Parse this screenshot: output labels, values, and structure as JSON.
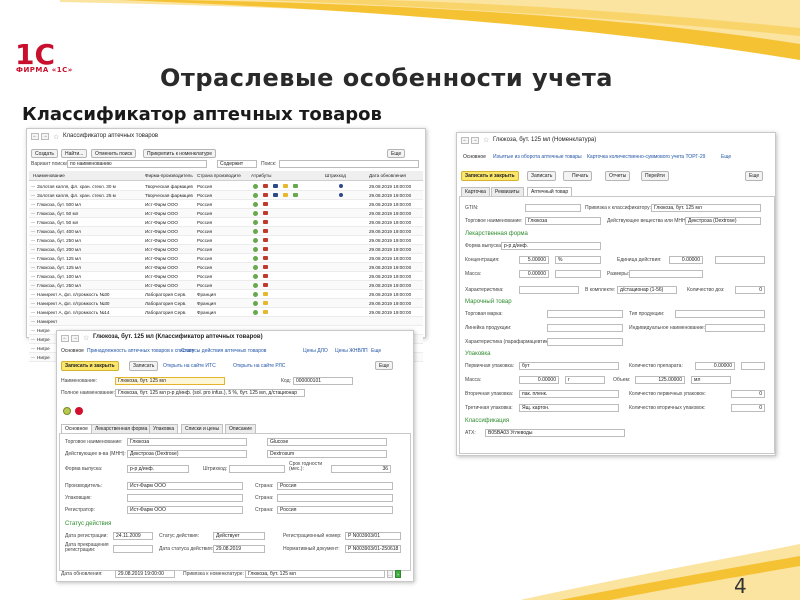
{
  "slide": {
    "logo_text": "1С",
    "logo_caption": "ФИРМА «1С»",
    "title": "Отраслевые особенности учета",
    "subtitle": "Классификатор аптечных товаров",
    "page_number": "4",
    "colors": {
      "swoosh": "#f5c233",
      "logo_red": "#c8102e",
      "section_green": "#2e8b2e",
      "link_blue": "#2255a6",
      "save_yellow": "#fbe66a"
    }
  },
  "list_window": {
    "title": "Классификатор аптечных товаров",
    "toolbar": [
      "Создать",
      "Найти...",
      "Отменить поиск",
      "Прикрепить к номенклатуре"
    ],
    "more": "Еще",
    "search_variant_label": "Вариант поиска:",
    "search_variant_value": "по наименованию",
    "search_mode": "Содержит",
    "search_label": "Поиск:",
    "columns": [
      "Наименование",
      "Фирма-производитель",
      "Страна производителя",
      "Атрибуты",
      "Штрихкод",
      "Дата обновления"
    ],
    "rows": [
      {
        "name": "Золотая капля, фл. хран. стекл. 30 м",
        "maker": "Творческая фармацев",
        "country": "Россия",
        "date": "29.08.2019 19:00:00"
      },
      {
        "name": "Золотая капля, фл. хран. стекл. 25 м",
        "maker": "Творческая фармацев",
        "country": "Россия",
        "date": "29.08.2019 19:00:00"
      },
      {
        "name": "Глюкоза, бут. 500 мл",
        "maker": "Ист-Фарм ООО",
        "country": "Россия",
        "date": "29.08.2019 19:00:00"
      },
      {
        "name": "Глюкоза, бут. 50 мл",
        "maker": "Ист-Фарм ООО",
        "country": "Россия",
        "date": "29.08.2019 19:00:00"
      },
      {
        "name": "Глюкоза, бут. 50 мл",
        "maker": "Ист-Фарм ООО",
        "country": "Россия",
        "date": "29.08.2019 19:00:00"
      },
      {
        "name": "Глюкоза, бут. 400 мл",
        "maker": "Ист-Фарм ООО",
        "country": "Россия",
        "date": "29.08.2019 19:00:00"
      },
      {
        "name": "Глюкоза, бут. 250 мл",
        "maker": "Ист-Фарм ООО",
        "country": "Россия",
        "date": "29.08.2019 19:00:00"
      },
      {
        "name": "Глюкоза, бут. 200 мл",
        "maker": "Ист-Фарм ООО",
        "country": "Россия",
        "date": "29.08.2019 19:00:00"
      },
      {
        "name": "Глюкоза, бут. 125 мл",
        "maker": "Ист-Фарм ООО",
        "country": "Россия",
        "date": "29.08.2019 19:00:00"
      },
      {
        "name": "Глюкоза, бут. 125 мл",
        "maker": "Ист-Фарм ООО",
        "country": "Россия",
        "date": "29.08.2019 19:00:00"
      },
      {
        "name": "Глюкоза, бут. 100 мл",
        "maker": "Ист-Фарм ООО",
        "country": "Россия",
        "date": "29.08.2019 19:00:00"
      },
      {
        "name": "Глюкоза, бут. 250 мл",
        "maker": "Ист-Фарм ООО",
        "country": "Россия",
        "date": "29.08.2019 19:00:00"
      },
      {
        "name": "Нанирект А, фл. п/громкость №30",
        "maker": "Лаборатория Серв.",
        "country": "Франция",
        "date": "29.08.2019 19:00:00"
      },
      {
        "name": "Нанирект А, фл. п/громкость №30",
        "maker": "Лаборатория Серв.",
        "country": "Франция",
        "date": "29.08.2019 19:00:00"
      },
      {
        "name": "Нанирект А, фл. п/громкость №14",
        "maker": "Лаборатория Серв.",
        "country": "Франция",
        "date": "29.08.2019 19:00:00"
      },
      {
        "name": "Нанирект",
        "maker": "",
        "country": "",
        "date": ""
      },
      {
        "name": "Нигре",
        "maker": "",
        "country": "",
        "date": ""
      },
      {
        "name": "Нигре",
        "maker": "",
        "country": "",
        "date": ""
      },
      {
        "name": "Нигре",
        "maker": "",
        "country": "",
        "date": ""
      },
      {
        "name": "Нигре",
        "maker": "",
        "country": "",
        "date": ""
      }
    ]
  },
  "item_window": {
    "title": "Глюкоза, бут. 125 мл (Классификатор аптечных товаров)",
    "nav_tabs": [
      "Основное",
      "Принадлежность аптечных товаров к спискам",
      "Статусы действия аптечных товаров",
      "Цены ДЛО",
      "Цены ЖНВЛП",
      "Еще"
    ],
    "buttons": [
      "Записать и закрыть",
      "Записать",
      "Открыть на сайте ИТС",
      "Открыть на сайте РЛС"
    ],
    "more": "Еще",
    "name_label": "Наименование:",
    "name_value": "Глюкоза, бут. 125 мл",
    "code_label": "Код:",
    "code_value": "000000101",
    "fullname_label": "Полное наименование:",
    "fullname_value": "Глюкоза, бут. 125 мл р-р д/инф. (sol. pro infus.), 5 %, бут. 125 мл, д/стационар",
    "tabs": [
      "Основное",
      "Лекарственная форма",
      "Упаковка",
      "Списки и цены",
      "Описание"
    ],
    "trade_name_label": "Торговое наименование:",
    "trade_name_value": "Глюкоза",
    "trade_name_latin": "Glucose",
    "mnn_label": "Действующее в-ва (МНН):",
    "mnn_value": "Декстроза (Dextrose)",
    "mnn_latin": "Dextrosum",
    "form_label": "Форма выпуска:",
    "form_value": "р-р д/инф.",
    "barcode_label": "Штрихкод:",
    "shelf_label": "Срок годности (мес.):",
    "shelf_value": "36",
    "manufacturer_label": "Производитель:",
    "manufacturer_value": "Ист-Фарм ООО",
    "country_label": "Страна:",
    "country_value": "Россия",
    "packer_label": "Упаковщик:",
    "registrant_label": "Регистратор:",
    "registrant_value": "Ист-Фарм ООО",
    "status_section": "Статус действия",
    "reg_date_label": "Дата регистрации:",
    "reg_date_value": "24.11.2009",
    "status_label": "Статус действия:",
    "status_value": "Действует",
    "reg_number_label": "Регистрационный номер:",
    "reg_number_value": "Р N003903/01",
    "stop_date_label": "Дата прекращения регистрации:",
    "status_date_label": "Дата статуса действия:",
    "status_date_value": "29.08.2019",
    "norm_doc_label": "Нормативный документ:",
    "norm_doc_value": "Р N003903/01-250618",
    "update_label": "Дата обновления:",
    "update_value": "29.08.2019 19:00:00",
    "binding_label": "Привязка к номенклатуре:",
    "binding_value": "Глюкоза, бут. 125 мл"
  },
  "nomenclature_window": {
    "title": "Глюкоза, бут. 125 мл (Номенклатура)",
    "nav_links": [
      "Основное",
      "Изъятые из оборота аптечные товары",
      "Карточка количественно-суммового учета ТОРГ-29",
      "Еще"
    ],
    "buttons": [
      "Записать и закрыть",
      "Записать",
      "Печать",
      "Отчеты",
      "Перейти"
    ],
    "more": "Еще",
    "tabs": [
      "Карточка",
      "Реквизиты",
      "Аптечный товар"
    ],
    "gtin_label": "GTIN:",
    "classifier_link_label": "Привязка к классификатору:",
    "classifier_link_value": "Глюкоза, бут. 125 мл",
    "trade_name_label": "Торговое наименование:",
    "trade_name_value": "Глюкоза",
    "mnn_label": "Действующее вещества или МНН:",
    "mnn_value": "Декстроза (Dextrose)",
    "section_drug_form": "Лекарственная форма",
    "form_label": "Форма выпуска:",
    "form_value": "р-р д/инф.",
    "concentration_label": "Концентрация:",
    "concentration_value": "5.00000",
    "concentration_unit": "%",
    "unit_label": "Единица действия:",
    "unit_value": "0.00000",
    "mass_label": "Масса:",
    "mass_value": "0.00000",
    "sizes_label": "Размеры:",
    "characteristics_label": "Характеристика:",
    "in_kit_label": "В комплекте:",
    "in_kit_value": "д/стационар (1-56)",
    "dose_count_label": "Количество доз:",
    "dose_count_value": "0",
    "section_brand": "Марочный товар",
    "trade_mark_label": "Торговая марка:",
    "product_type_label": "Тип продукции:",
    "product_line_label": "Линейка продукции:",
    "individual_name_label": "Индивидуальное наименование:",
    "pharm_char_label": "Характеристика (парафармацевтика):",
    "section_pack": "Упаковка",
    "primary_pack_label": "Первичная упаковка:",
    "primary_pack_value": "бут",
    "drug_amount_label": "Количество препарата:",
    "drug_amount_value": "0.00000",
    "pack_mass_label": "Масса:",
    "pack_mass_value": "0.00000",
    "pack_mass_unit": "г",
    "volume_label": "Объем:",
    "volume_value": "125.00000",
    "volume_unit": "мл",
    "secondary_pack_label": "Вторичная упаковка:",
    "secondary_pack_value": "пак. пленк.",
    "primary_count_label": "Количество первичных упаковок:",
    "primary_count_value": "0",
    "tertiary_pack_label": "Третичная упаковка:",
    "tertiary_pack_value": "Ящ. картон.",
    "secondary_count_label": "Количество вторичных упаковок:",
    "secondary_count_value": "0",
    "section_class": "Классификация",
    "atc_label": "АТХ:",
    "atc_value": "В05ВА03 Углеводы"
  }
}
